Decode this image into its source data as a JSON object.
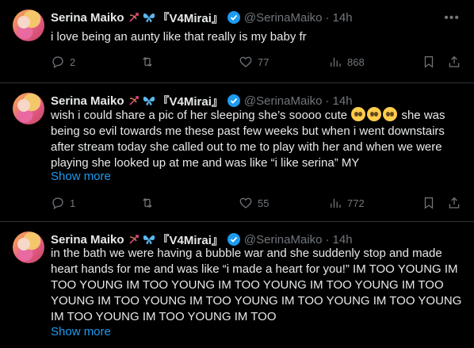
{
  "tweets": [
    {
      "name": "Serina Maiko",
      "name_suffix": "『V4Mirai』",
      "handle": "@SerinaMaiko",
      "time": "14h",
      "text": "i love being an aunty like that really is my baby fr",
      "replies": "2",
      "retweets": "",
      "likes": "77",
      "views": "868"
    },
    {
      "name": "Serina Maiko",
      "name_suffix": "『V4Mirai』",
      "handle": "@SerinaMaiko",
      "time": "14h",
      "text_part1": "wish i could share a pic of her sleeping she’s soooo cute",
      "text_part2": "she was being so evil towards me these past few weeks but when i went downstairs after stream today she called out to me to play with her and when we were playing she looked up at me and was like “i like serina” MY",
      "show_more": "Show more",
      "replies": "1",
      "retweets": "",
      "likes": "55",
      "views": "772"
    },
    {
      "name": "Serina Maiko",
      "name_suffix": "『V4Mirai』",
      "handle": "@SerinaMaiko",
      "time": "14h",
      "text": "in the bath we were having a bubble war and she suddenly stop and made heart hands for me and was like “i made a heart for you!” IM TOO YOUNG IM TOO YOUNG IM TOO YOUNG IM TOO YOUNG IM TOO YOUNG IM TOO YOUNG IM TOO YOUNG IM TOO YOUNG IM TOO YOUNG IM TOO YOUNG IM TOO YOUNG IM TOO YOUNG IM TOO",
      "show_more": "Show more"
    }
  ],
  "colors": {
    "background": "#000000",
    "text": "#e7e9ea",
    "muted": "#71767b",
    "link": "#1d9bf0",
    "verified": "#1d9bf0",
    "border": "#2f3336"
  },
  "icons": [
    "more-icon",
    "bow-arrow-icon",
    "butterfly-icon",
    "verified-badge-icon",
    "reply-icon",
    "retweet-icon",
    "like-icon",
    "views-icon",
    "bookmark-icon",
    "share-icon",
    "pleading-face-icon"
  ]
}
